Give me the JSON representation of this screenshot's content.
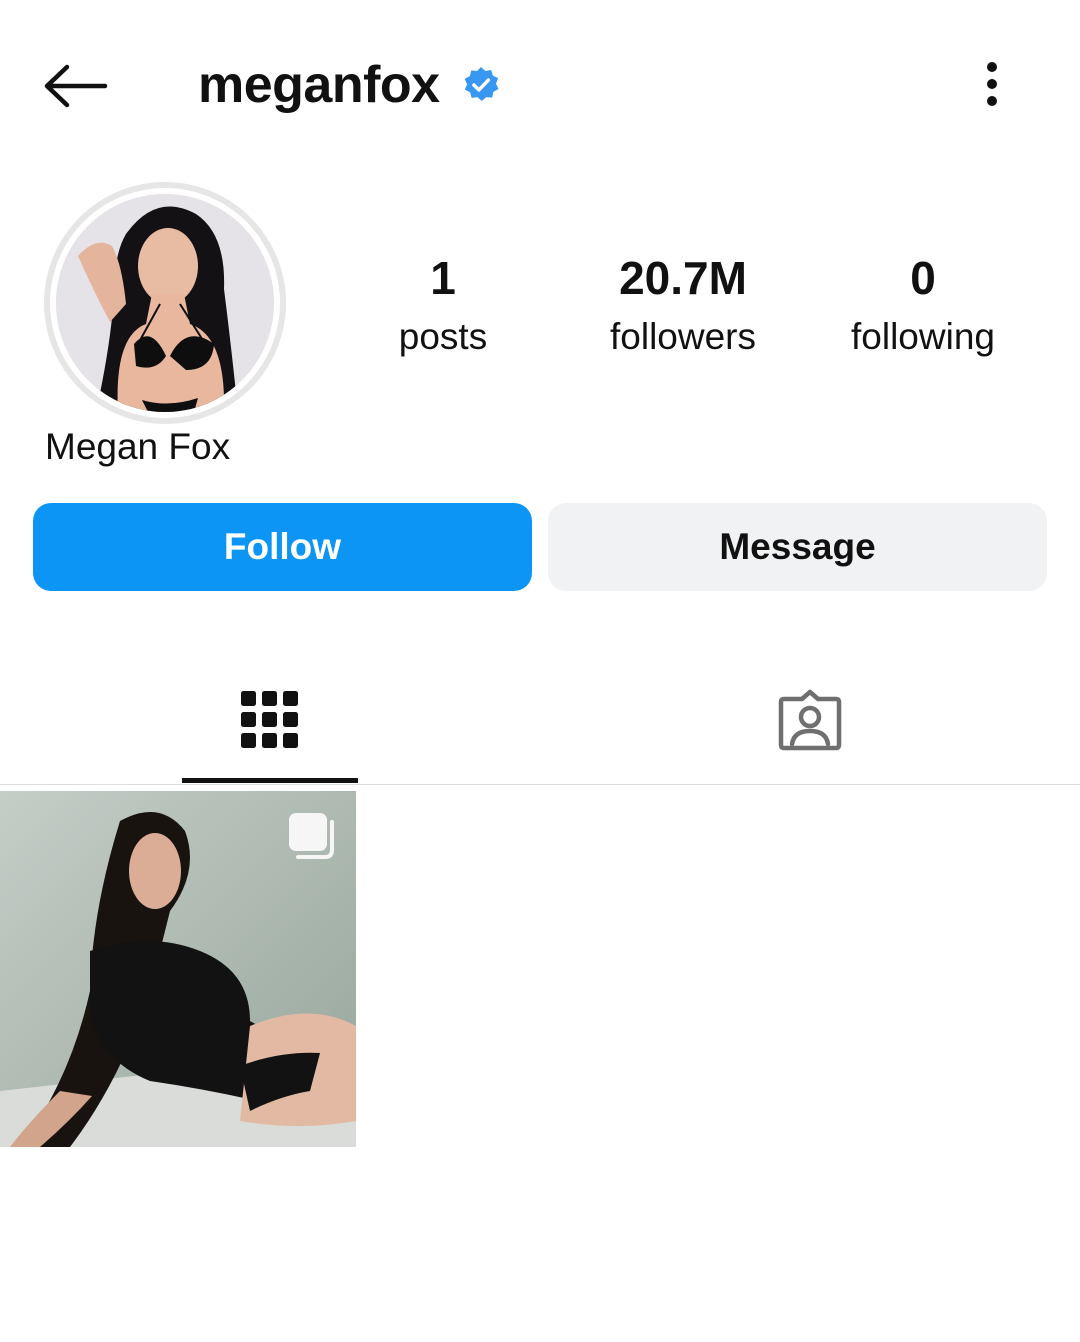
{
  "header": {
    "username": "meganfox",
    "verified": true,
    "back_icon": "arrow-left-icon",
    "more_icon": "vertical-dots-icon",
    "verified_color": "#3897f0"
  },
  "profile": {
    "display_name": "Megan Fox",
    "stats": [
      {
        "value": "1",
        "label": "posts"
      },
      {
        "value": "20.7M",
        "label": "followers"
      },
      {
        "value": "0",
        "label": "following"
      }
    ]
  },
  "actions": {
    "follow_label": "Follow",
    "message_label": "Message",
    "follow_color": "#0d95f6"
  },
  "tabs": [
    {
      "name": "posts-grid",
      "icon": "grid-icon",
      "active": true
    },
    {
      "name": "tagged",
      "icon": "tagged-person-icon",
      "active": false
    }
  ],
  "posts": [
    {
      "type": "carousel",
      "icon": "multiple-images-icon"
    }
  ]
}
